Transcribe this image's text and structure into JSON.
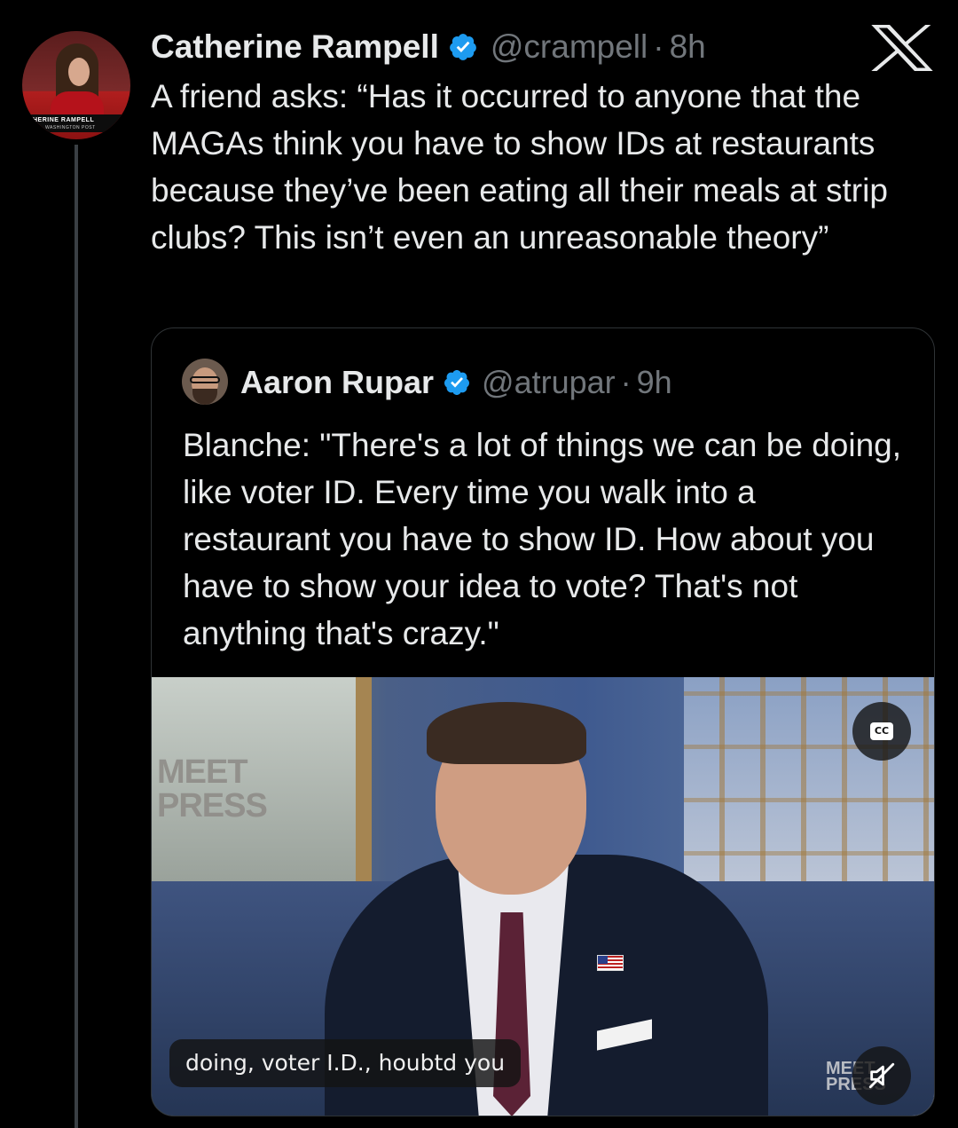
{
  "tweet": {
    "author": {
      "display_name": "Catherine Rampell",
      "handle": "@crampell",
      "separator": "·",
      "time": "8h",
      "verified": true,
      "avatar_banner": "HERINE RAMPELL",
      "avatar_banner_sub": "WASHINGTON POST"
    },
    "text": "A friend asks: “Has it occurred to anyone that the MAGAs think you have to show IDs at restaurants because they’ve been eating all their meals at strip clubs? This isn’t even an unreasonable theory”"
  },
  "quote": {
    "author": {
      "display_name": "Aaron Rupar",
      "handle": "@atrupar",
      "separator": "·",
      "time": "9h",
      "verified": true
    },
    "text": "Blanche: \"There's a lot of things we can be doing, like voter ID. Every time you walk into a restaurant you have to show ID. How about you have to show your idea to vote? That's not anything that's crazy.\"",
    "video": {
      "caption": "doing, voter I.D., houbtd you",
      "cc_label": "CC",
      "set_logo": "MEET\nPRESS",
      "corner_logo": "MEET\nTHE PRESS"
    }
  },
  "icons": {
    "close": "x-logo-icon",
    "verified": "verified-badge-icon",
    "captions": "closed-captions-icon",
    "mute": "muted-speaker-icon"
  },
  "colors": {
    "background": "#000000",
    "text_primary": "#e7e9ea",
    "text_secondary": "#71767b",
    "verified_blue": "#1d9bf0",
    "border": "#2f3336"
  }
}
